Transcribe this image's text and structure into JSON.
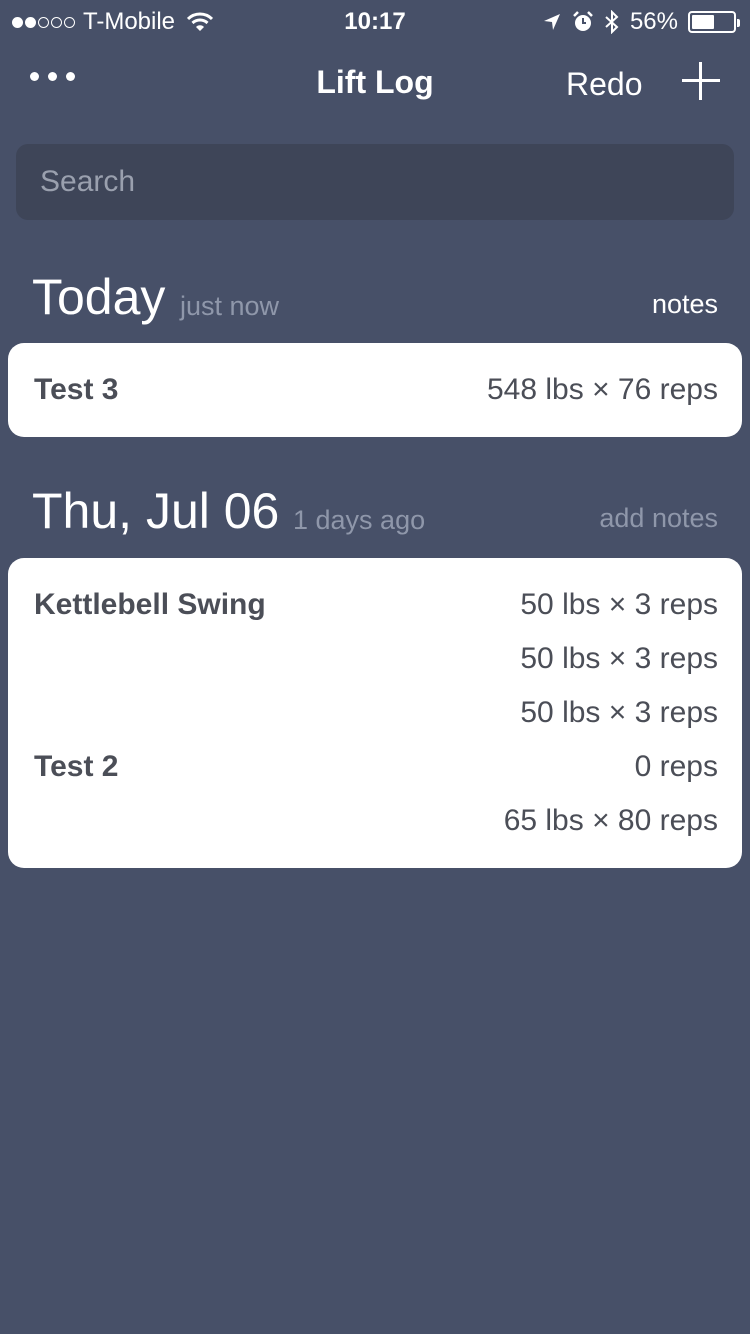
{
  "status_bar": {
    "carrier": "T-Mobile",
    "time": "10:17",
    "battery_percent": "56%",
    "battery_level": 0.56,
    "signal_filled": 2,
    "signal_total": 5
  },
  "nav": {
    "title": "Lift Log",
    "redo_label": "Redo",
    "more_icon": "more-icon",
    "add_icon": "plus-icon"
  },
  "search": {
    "placeholder": "Search"
  },
  "sections": [
    {
      "title": "Today",
      "ago": "just now",
      "notes_label": "notes",
      "entries": [
        {
          "exercise": "Test 3",
          "set": "548 lbs × 76 reps"
        }
      ]
    },
    {
      "title": "Thu, Jul 06",
      "ago": "1 days ago",
      "notes_label": "add notes",
      "entries": [
        {
          "exercise": "Kettlebell Swing",
          "set": "50 lbs × 3 reps"
        },
        {
          "exercise": "",
          "set": "50 lbs × 3 reps"
        },
        {
          "exercise": "",
          "set": "50 lbs × 3 reps"
        },
        {
          "exercise": "Test 2",
          "set": "0 reps"
        },
        {
          "exercise": "",
          "set": "65 lbs × 80 reps"
        }
      ]
    }
  ],
  "colors": {
    "background": "#475068",
    "search_background": "#3e4558",
    "secondary_text": "#8f97aa",
    "card_text": "#4b4e57"
  }
}
